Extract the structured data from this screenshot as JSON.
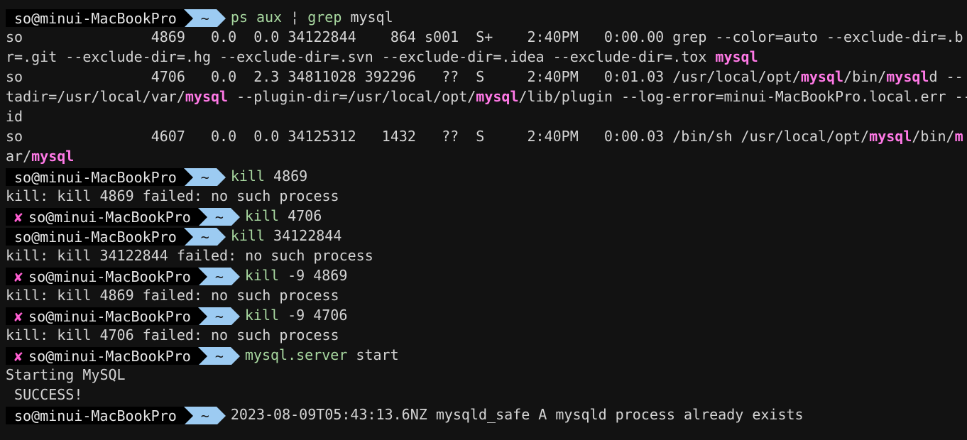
{
  "prompt": {
    "host": "so@minui-MacBookPro",
    "dir": "~",
    "error_icon": "✘"
  },
  "colors": {
    "background": "#121212",
    "host_bg": "#000000",
    "dir_bg": "#9ccbf2",
    "command": "#a8d8a0",
    "highlight": "#ff79e6",
    "error_icon": "#ff5fd2"
  },
  "lines": [
    {
      "type": "prompt",
      "error": false,
      "cmd": [
        {
          "t": "ps aux ",
          "c": "g"
        },
        {
          "t": "¦ ",
          "c": "p"
        },
        {
          "t": "grep ",
          "c": "g"
        },
        {
          "t": "mysql",
          "c": "p"
        }
      ]
    },
    {
      "type": "output",
      "parts": [
        {
          "t": "so               4869   0.0  0.0 34122844    864 s001  S+    2:40PM   0:00.00 grep --color=auto --exclude-dir=.b"
        }
      ]
    },
    {
      "type": "output",
      "parts": [
        {
          "t": "r=.git --exclude-dir=.hg --exclude-dir=.svn --exclude-dir=.idea --exclude-dir=.tox "
        },
        {
          "t": "mysql",
          "h": true
        }
      ]
    },
    {
      "type": "output",
      "parts": [
        {
          "t": "so               4706   0.0  2.3 34811028 392296   ??  S     2:40PM   0:01.03 /usr/local/opt/"
        },
        {
          "t": "mysql",
          "h": true
        },
        {
          "t": "/bin/"
        },
        {
          "t": "mysql",
          "h": true
        },
        {
          "t": "d --"
        }
      ]
    },
    {
      "type": "output",
      "parts": [
        {
          "t": "tadir=/usr/local/var/"
        },
        {
          "t": "mysql",
          "h": true
        },
        {
          "t": " --plugin-dir=/usr/local/opt/"
        },
        {
          "t": "mysql",
          "h": true
        },
        {
          "t": "/lib/plugin --log-error=minui-MacBookPro.local.err --"
        }
      ]
    },
    {
      "type": "output",
      "parts": [
        {
          "t": "id"
        }
      ]
    },
    {
      "type": "output",
      "parts": [
        {
          "t": "so               4607   0.0  0.0 34125312   1432   ??  S     2:40PM   0:00.03 /bin/sh /usr/local/opt/"
        },
        {
          "t": "mysql",
          "h": true
        },
        {
          "t": "/bin/"
        },
        {
          "t": "m",
          "h": true
        }
      ]
    },
    {
      "type": "output",
      "parts": [
        {
          "t": "ar/"
        },
        {
          "t": "mysql",
          "h": true
        }
      ]
    },
    {
      "type": "prompt",
      "error": false,
      "cmd": [
        {
          "t": "kill ",
          "c": "g"
        },
        {
          "t": "4869",
          "c": "p"
        }
      ]
    },
    {
      "type": "output",
      "parts": [
        {
          "t": "kill: kill 4869 failed: no such process"
        }
      ]
    },
    {
      "type": "prompt",
      "error": true,
      "cmd": [
        {
          "t": "kill ",
          "c": "g"
        },
        {
          "t": "4706",
          "c": "p"
        }
      ]
    },
    {
      "type": "prompt",
      "error": false,
      "cmd": [
        {
          "t": "kill ",
          "c": "g"
        },
        {
          "t": "34122844",
          "c": "p"
        }
      ]
    },
    {
      "type": "output",
      "parts": [
        {
          "t": "kill: kill 34122844 failed: no such process"
        }
      ]
    },
    {
      "type": "prompt",
      "error": true,
      "cmd": [
        {
          "t": "kill ",
          "c": "g"
        },
        {
          "t": "-9 4869",
          "c": "p"
        }
      ]
    },
    {
      "type": "output",
      "parts": [
        {
          "t": "kill: kill 4869 failed: no such process"
        }
      ]
    },
    {
      "type": "prompt",
      "error": true,
      "cmd": [
        {
          "t": "kill ",
          "c": "g"
        },
        {
          "t": "-9 4706",
          "c": "p"
        }
      ]
    },
    {
      "type": "output",
      "parts": [
        {
          "t": "kill: kill 4706 failed: no such process"
        }
      ]
    },
    {
      "type": "prompt",
      "error": true,
      "cmd": [
        {
          "t": "mysql.server ",
          "c": "g"
        },
        {
          "t": "start",
          "c": "p"
        }
      ]
    },
    {
      "type": "output",
      "parts": [
        {
          "t": "Starting MySQL"
        }
      ]
    },
    {
      "type": "output",
      "parts": [
        {
          "t": " SUCCESS!"
        }
      ]
    },
    {
      "type": "prompt",
      "error": false,
      "cmd": [
        {
          "t": "2023-08-09T05:43:13.6NZ mysqld_safe A mysqld process already exists",
          "c": "p"
        }
      ]
    }
  ]
}
